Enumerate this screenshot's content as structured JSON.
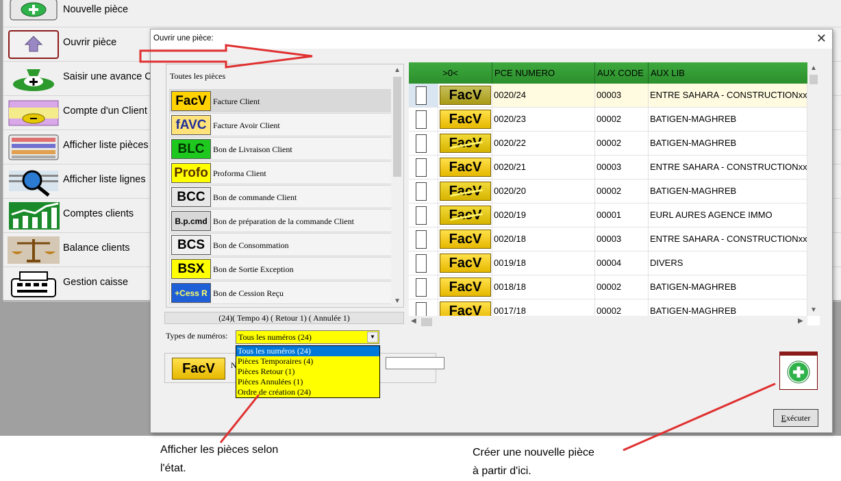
{
  "main_menu": {
    "items": [
      {
        "label": "Nouvelle pièce",
        "icon": "plus-circle-icon"
      },
      {
        "label": "Ouvrir pièce",
        "icon": "house-up-icon"
      },
      {
        "label": "Saisir une avance C",
        "icon": "money-bag-icon"
      },
      {
        "label": "Compte d'un Client",
        "icon": "account-card-icon"
      },
      {
        "label": "Afficher liste pièces",
        "icon": "list-stack-icon"
      },
      {
        "label": "Afficher liste lignes",
        "icon": "magnifier-icon"
      },
      {
        "label": "Comptes clients",
        "icon": "bar-chart-icon"
      },
      {
        "label": "Balance clients",
        "icon": "scales-icon"
      },
      {
        "label": "Gestion caisse",
        "icon": "cash-register-icon"
      }
    ]
  },
  "dialog": {
    "title": "Ouvrir une pièce:",
    "close_glyph": "✕",
    "doc_types": {
      "header": "Toutes les pièces",
      "items": [
        {
          "badge": "FacV",
          "label": "Facture Client",
          "bg": "#ffd200",
          "fg": "#000000"
        },
        {
          "badge": "fAVC",
          "label": "Facture Avoir Client",
          "bg": "#ffe27a",
          "fg": "#1f2f9a"
        },
        {
          "badge": "BLC",
          "label": "Bon de Livraison Client",
          "bg": "#1ec81e",
          "fg": "#003300"
        },
        {
          "badge": "Profo",
          "label": "Proforma Client",
          "bg": "#ffff00",
          "fg": "#5a3000"
        },
        {
          "badge": "BCC",
          "label": "Bon de commande Client",
          "bg": "#e8e8e8",
          "fg": "#000000"
        },
        {
          "badge": "B.p.cmd",
          "label": "Bon de préparation de la commande Client",
          "bg": "#d8d8d8",
          "fg": "#000000"
        },
        {
          "badge": "BCS",
          "label": "Bon de Consommation",
          "bg": "#f0f0f0",
          "fg": "#000000"
        },
        {
          "badge": "BSX",
          "label": "Bon de Sortie Exception",
          "bg": "#ffff00",
          "fg": "#000000"
        },
        {
          "badge": "+Cess R",
          "label": "Bon de Cession Reçu",
          "bg": "#1e5fd8",
          "fg": "#ffff66"
        }
      ],
      "status": "(24)( Tempo 4) ( Retour 1) ( Annulée 1)"
    },
    "types_numeros": {
      "label": "Types de numéros:",
      "selected": "Tous les numéros (24)",
      "options": [
        "Tous les numéros (24)",
        "Pièces Temporaires (4)",
        "Pièces Retour (1)",
        "Pièces Annulées (1)",
        "Ordre de création (24)"
      ]
    },
    "current_piece": {
      "badge": "FacV",
      "label_prefix": "N"
    },
    "grid": {
      "columns": [
        ">0<",
        "PCE NUMERO",
        "AUX CODE",
        "AUX LIB"
      ],
      "rows": [
        {
          "badge": "FacV",
          "style": "dim",
          "num": "0020/24",
          "code": "00003",
          "lib": "ENTRE SAHARA - CONSTRUCTIONxx"
        },
        {
          "badge": "FacV",
          "style": "normal",
          "num": "0020/23",
          "code": "00002",
          "lib": "BATIGEN-MAGHREB"
        },
        {
          "badge": "FacV",
          "style": "strike",
          "num": "0020/22",
          "code": "00002",
          "lib": "BATIGEN-MAGHREB"
        },
        {
          "badge": "FacV",
          "style": "normal",
          "num": "0020/21",
          "code": "00003",
          "lib": "ENTRE SAHARA - CONSTRUCTIONxx"
        },
        {
          "badge": "FacV",
          "style": "strike",
          "num": "0020/20",
          "code": "00002",
          "lib": "BATIGEN-MAGHREB"
        },
        {
          "badge": "FacV",
          "style": "strike",
          "num": "0020/19",
          "code": "00001",
          "lib": "EURL AURES AGENCE IMMO"
        },
        {
          "badge": "FacV",
          "style": "normal",
          "num": "0020/18",
          "code": "00003",
          "lib": "ENTRE SAHARA - CONSTRUCTIONxx"
        },
        {
          "badge": "FacV",
          "style": "normal",
          "num": "0019/18",
          "code": "00004",
          "lib": "DIVERS"
        },
        {
          "badge": "FacV",
          "style": "normal",
          "num": "0018/18",
          "code": "00002",
          "lib": "BATIGEN-MAGHREB"
        },
        {
          "badge": "FacV",
          "style": "normal",
          "num": "0017/18",
          "code": "00002",
          "lib": "BATIGEN-MAGHREB"
        }
      ]
    },
    "execute_label": "Exécuter",
    "execute_mnemonic": "E",
    "execute_rest": "xécuter"
  },
  "annotations": {
    "left": "Afficher les pièces  selon\nl'état.",
    "right": "Créer une nouvelle pièce\nà partir d'ici.",
    "arrow_color": "#e03030"
  }
}
